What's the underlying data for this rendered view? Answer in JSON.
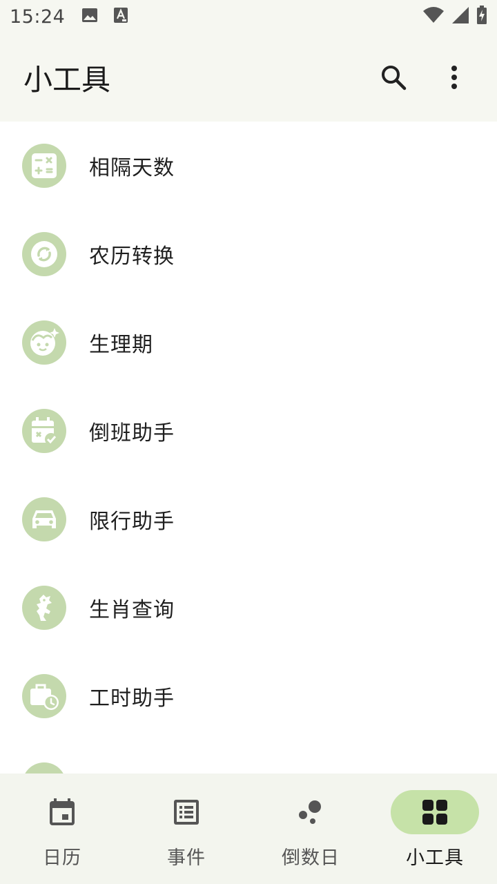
{
  "status_bar": {
    "time": "15:24",
    "left_icons": [
      "image-icon",
      "font-icon"
    ],
    "right_icons": [
      "wifi-icon",
      "cell-signal-icon",
      "battery-charging-icon"
    ]
  },
  "app_bar": {
    "title": "小工具",
    "actions": [
      "search-icon",
      "more-vert-icon"
    ]
  },
  "tools": [
    {
      "label": "相隔天数",
      "icon": "calculator-icon"
    },
    {
      "label": "农历转换",
      "icon": "convert-icon"
    },
    {
      "label": "生理期",
      "icon": "face-icon"
    },
    {
      "label": "倒班助手",
      "icon": "calendar-check-icon"
    },
    {
      "label": "限行助手",
      "icon": "car-icon"
    },
    {
      "label": "生肖查询",
      "icon": "zodiac-icon"
    },
    {
      "label": "工时助手",
      "icon": "work-time-icon"
    },
    {
      "label": "",
      "icon": "partial-icon"
    }
  ],
  "bottom_nav": {
    "items": [
      {
        "label": "日历",
        "icon": "calendar-icon",
        "active": false
      },
      {
        "label": "事件",
        "icon": "list-icon",
        "active": false
      },
      {
        "label": "倒数日",
        "icon": "bubbles-icon",
        "active": false
      },
      {
        "label": "小工具",
        "icon": "grid-icon",
        "active": true
      }
    ]
  },
  "colors": {
    "accent_icon_bg": "#c4d9ad",
    "nav_active_pill": "#c6e2a8",
    "bar_bg": "#f6f7f1"
  }
}
